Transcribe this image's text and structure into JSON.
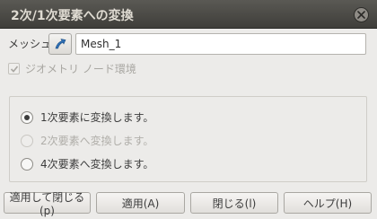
{
  "window": {
    "title": "2次/1次要素への変換",
    "close_icon": "close-icon"
  },
  "mesh": {
    "label": "メッシュ",
    "select_icon": "mesh-select-arrow-icon",
    "value": "Mesh_1"
  },
  "geometry_check": {
    "label": "ジオメトリ ノード環境",
    "checked": true,
    "enabled": false
  },
  "options": [
    {
      "label": "1次要素に変換します。",
      "selected": true,
      "enabled": true
    },
    {
      "label": "2次要素へ変換します。",
      "selected": false,
      "enabled": false
    },
    {
      "label": "4次要素へ変換します。",
      "selected": false,
      "enabled": true
    }
  ],
  "buttons": {
    "apply_close": "適用して閉じる(p)",
    "apply": "適用(A)",
    "close": "閉じる(l)",
    "help": "ヘルプ(H)"
  },
  "colors": {
    "titlebar": "#4a4945",
    "background": "#ecebe9",
    "icon_blue": "#2e6fb5"
  }
}
